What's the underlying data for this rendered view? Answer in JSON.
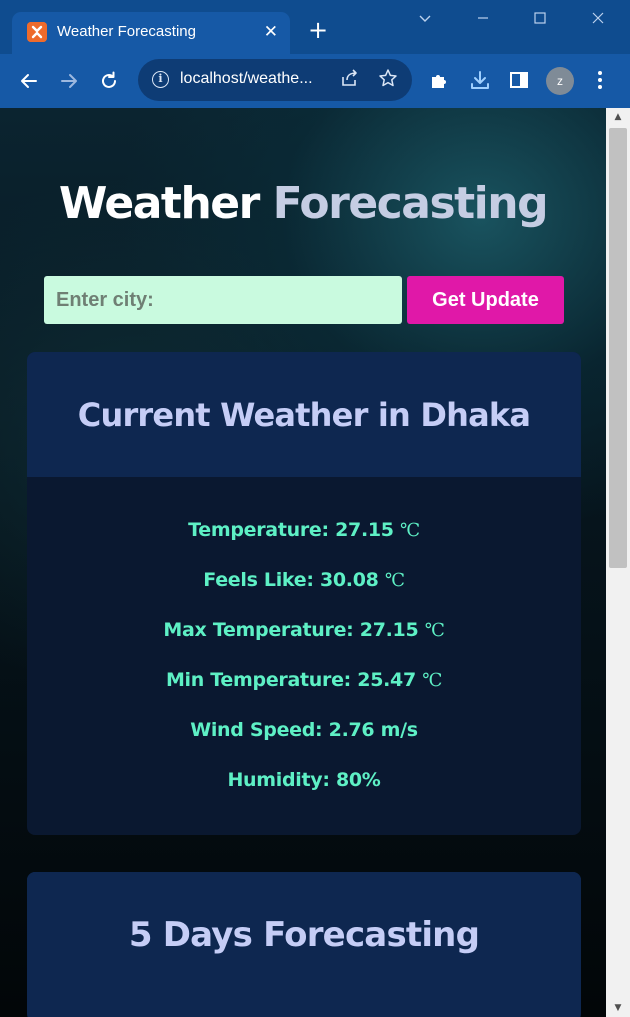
{
  "browser": {
    "tab_title": "Weather Forecasting",
    "favicon_label": "⛋",
    "tab_close": "✕",
    "new_tab": "+",
    "url": "localhost/weathe...",
    "avatar_initial": "z"
  },
  "page": {
    "title_part1": "Weather",
    "title_part2": "Forecasting"
  },
  "search": {
    "placeholder": "Enter city:",
    "button_label": "Get Update"
  },
  "current_weather": {
    "heading": "Current Weather in Dhaka",
    "temperature_label": "Temperature: 27.15",
    "feels_like_label": "Feels Like: 30.08",
    "max_temp_label": "Max Temperature: 27.15",
    "min_temp_label": "Min Temperature: 25.47",
    "wind_speed_label": "Wind Speed: 2.76 m/s",
    "humidity_label": "Humidity: 80%",
    "unit": "℃"
  },
  "forecast": {
    "heading": "5 Days Forecasting"
  },
  "colors": {
    "accent_button": "#e018a8",
    "input_bg": "#c9fadf",
    "weather_text": "#5ef0c5",
    "card_header": "#0e2750"
  }
}
